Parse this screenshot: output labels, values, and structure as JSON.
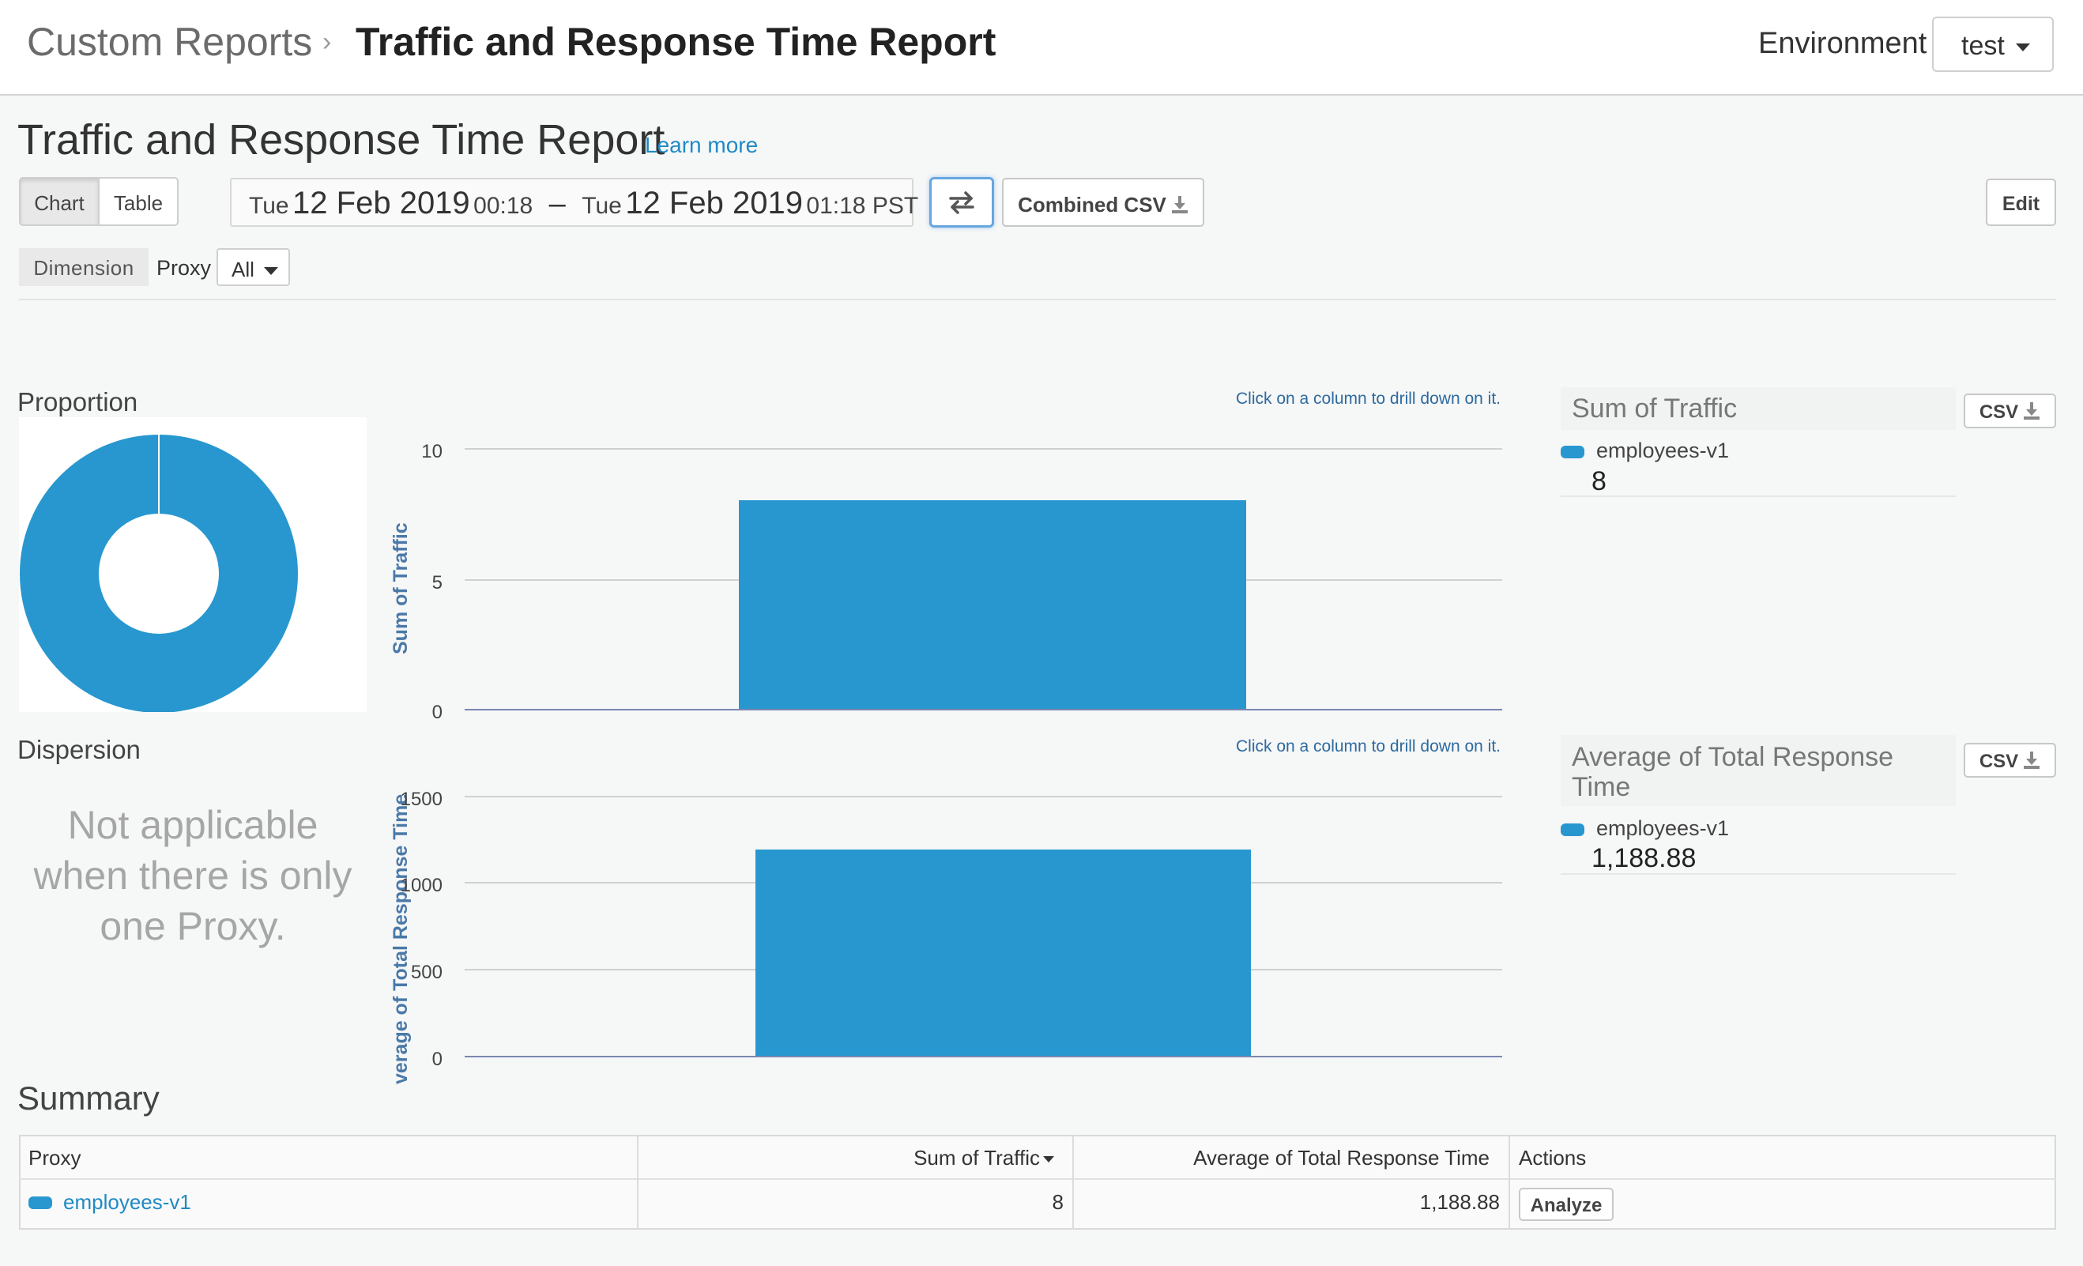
{
  "breadcrumb": {
    "parent": "Custom Reports",
    "separator": "›",
    "current": "Traffic and Response Time Report"
  },
  "environment": {
    "label": "Environment",
    "value": "test"
  },
  "page": {
    "title": "Traffic and Response Time Report",
    "learn_more": "Learn more"
  },
  "toolbar": {
    "view_tabs": [
      "Chart",
      "Table"
    ],
    "active_tab": "Chart",
    "date_range": {
      "start_day": "Tue",
      "start_date": "12 Feb 2019",
      "start_time": "00:18",
      "dash": "–",
      "end_day": "Tue",
      "end_date": "12 Feb 2019",
      "end_time": "01:18 PST"
    },
    "swap_icon": "swap-arrows-icon",
    "combined_csv": "Combined CSV",
    "edit": "Edit"
  },
  "filters": {
    "dimension": "Dimension",
    "proxy_label": "Proxy",
    "proxy_value": "All"
  },
  "proportion": {
    "title": "Proportion"
  },
  "dispersion": {
    "title": "Dispersion",
    "message": "Not applicable when there is only one Proxy."
  },
  "charts": {
    "drill_note": "Click on a column to drill down on it.",
    "csv_label": "CSV"
  },
  "chart_data": [
    {
      "type": "pie",
      "title": "Proportion",
      "categories": [
        "employees-v1"
      ],
      "values": [
        100
      ],
      "color": "#2897cf"
    },
    {
      "type": "bar",
      "title": "Sum of Traffic",
      "ylabel": "Sum of Traffic",
      "categories": [
        "employees-v1"
      ],
      "values": [
        8
      ],
      "ylim": [
        0,
        10
      ],
      "yticks": [
        "0",
        "5",
        "10"
      ],
      "color": "#2897cf"
    },
    {
      "type": "bar",
      "title": "Average of Total Response Time",
      "ylabel": "Average of Total Response Time",
      "ylabel_visible": "verage of Total Response Time",
      "categories": [
        "employees-v1"
      ],
      "values": [
        1188.88
      ],
      "ylim": [
        0,
        1500
      ],
      "yticks": [
        "0",
        "500",
        "1000",
        "1500"
      ],
      "color": "#2897cf"
    }
  ],
  "legends": {
    "traffic": {
      "title": "Sum of Traffic",
      "series_name": "employees-v1",
      "value": "8"
    },
    "response": {
      "title": "Average of Total Response Time",
      "series_name": "employees-v1",
      "value": "1,188.88"
    }
  },
  "summary": {
    "title": "Summary",
    "headers": {
      "proxy": "Proxy",
      "traffic": "Sum of Traffic",
      "response": "Average of Total Response Time",
      "actions": "Actions"
    },
    "rows": [
      {
        "proxy": "employees-v1",
        "traffic": "8",
        "response": "1,188.88",
        "action": "Analyze"
      }
    ]
  },
  "colors": {
    "series": "#2897cf",
    "link": "#1f8ac5",
    "axis_title": "#4a79a8"
  }
}
